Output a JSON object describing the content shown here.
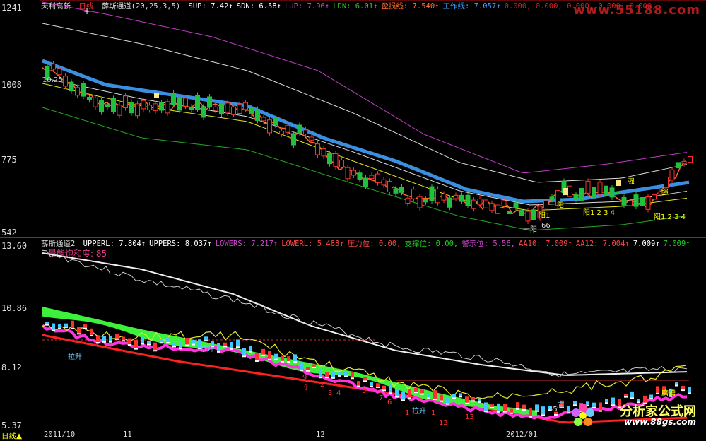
{
  "upper": {
    "stock": "天利高新",
    "period": "日线",
    "indicator": "薛斯通道(20,25,3,5)",
    "items": [
      {
        "text": "SUP: 7.42↑",
        "color": "#ffffff"
      },
      {
        "text": "SDN: 6.58↑",
        "color": "#ffffff"
      },
      {
        "text": "LUP: 7.96↑",
        "color": "#d047d0"
      },
      {
        "text": "LDN: 6.01↑",
        "color": "#22cc22"
      },
      {
        "text": "盈损线: 7.540↑",
        "color": "#ff6a2a"
      },
      {
        "text": "工作线: 7.057↑",
        "color": "#3aa0ff"
      },
      {
        "text": "0.000, 0.000, 0.000, 0.000, 0.000,",
        "color": "#cc2222"
      }
    ],
    "yticks": [
      "1241",
      "1008",
      "775",
      "542"
    ],
    "annotations": [
      "阳1",
      "阳",
      "阳1 2 3 4",
      "强",
      "阳1 2 3 4",
      "一阳",
      "66",
      "强"
    ],
    "first_value": "10.25"
  },
  "lower": {
    "indicator": "薛斯通道2",
    "items": [
      {
        "text": "UPPERL: 7.804↑",
        "color": "#ffffff"
      },
      {
        "text": "UPPERS: 8.037↑",
        "color": "#ffffff"
      },
      {
        "text": "LOWERS: 7.217↑",
        "color": "#d047d0"
      },
      {
        "text": "LOWERL: 5.483↑",
        "color": "#ff4444"
      },
      {
        "text": "压力位: 0.00,",
        "color": "#ff4444"
      },
      {
        "text": "支撑位: 0.00,",
        "color": "#22cc22"
      },
      {
        "text": "警示位: 5.56,",
        "color": "#d047d0"
      },
      {
        "text": "AA10: 7.009↑",
        "color": "#ff4444"
      },
      {
        "text": "AA12: 7.004↑",
        "color": "#ff4444"
      },
      {
        "text": "7.009↑",
        "color": "#ffffff"
      },
      {
        "text": "7.009↑",
        "color": "#22cc22"
      }
    ],
    "saturation": "量能饱和度: 85",
    "yticks": [
      "13.60",
      "10.86",
      "8.12",
      "5.37"
    ],
    "labels": [
      "拉升",
      "拉升",
      "拉升",
      "9",
      "2",
      "3",
      "4",
      "5",
      "6",
      "7",
      "1",
      "1",
      "13",
      "12",
      "45",
      "底",
      "磨蹭"
    ]
  },
  "xaxis": {
    "tab": "日线▲",
    "labels": [
      "2011/10",
      "11",
      "12",
      "2012/01"
    ]
  },
  "brand": {
    "title": "分析家公式网",
    "url": "www.88gs.com",
    "watermark": "www.55188.com"
  }
}
